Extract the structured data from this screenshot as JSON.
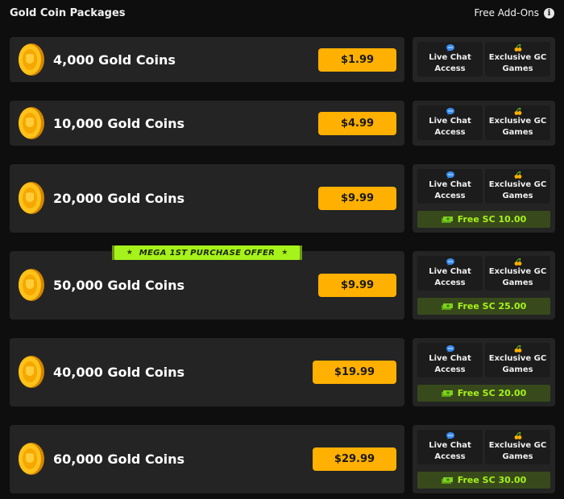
{
  "header": {
    "title": "Gold Coin Packages",
    "addons_label": "Free Add-Ons",
    "info_glyph": "i"
  },
  "addons": {
    "live_chat": "Live Chat\nAccess",
    "exclusive_gc": "Exclusive GC\nGames"
  },
  "promo_ribbon": {
    "text": "MEGA 1ST PURCHASE OFFER",
    "star": "★"
  },
  "packages": [
    {
      "coins": "4,000 Gold Coins",
      "price": "$1.99",
      "free_sc": ""
    },
    {
      "coins": "10,000 Gold Coins",
      "price": "$4.99",
      "free_sc": ""
    },
    {
      "coins": "20,000 Gold Coins",
      "price": "$9.99",
      "free_sc": "Free SC 10.00"
    },
    {
      "coins": "50,000 Gold Coins",
      "price": "$9.99",
      "free_sc": "Free SC 25.00"
    },
    {
      "coins": "40,000 Gold Coins",
      "price": "$19.99",
      "free_sc": "Free SC 20.00"
    },
    {
      "coins": "60,000 Gold Coins",
      "price": "$29.99",
      "free_sc": "Free SC 30.00"
    }
  ],
  "colors": {
    "accent": "#ffb000",
    "bonus_green": "#a6f21b",
    "card_bg": "#242424",
    "page_bg": "#0e0e0e"
  },
  "icons": {
    "coin": "gold-coin-icon",
    "chat": "chat-bubble-icon",
    "games": "cherries-icon",
    "money": "money-stack-icon",
    "info": "info-icon"
  }
}
